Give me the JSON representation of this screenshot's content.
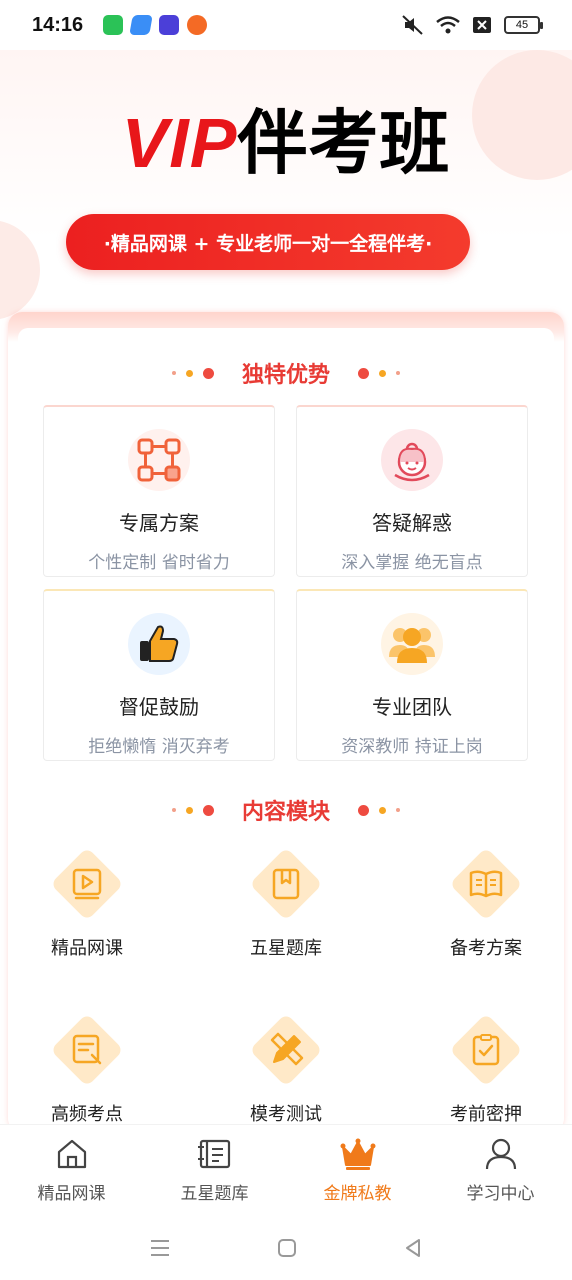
{
  "status_bar": {
    "time": "14:16",
    "battery": "45",
    "icons": [
      "wechat-app-icon",
      "app-blue-icon",
      "game-app-icon",
      "browser-app-icon",
      "mute-icon",
      "wifi-icon",
      "sim-x-icon"
    ]
  },
  "header": {
    "title_vip": "VIP",
    "title_cn": "伴考班",
    "tagline": "·精品网课 + 专业老师一对一全程伴考·"
  },
  "advantages": {
    "title": "独特优势",
    "items": [
      {
        "title": "专属方案",
        "subtitle": "个性定制 省时省力",
        "icon": "plan-network-icon"
      },
      {
        "title": "答疑解惑",
        "subtitle": "深入掌握 绝无盲点",
        "icon": "customer-service-icon"
      },
      {
        "title": "督促鼓励",
        "subtitle": "拒绝懒惰 消灭弃考",
        "icon": "thumbs-up-icon"
      },
      {
        "title": "专业团队",
        "subtitle": "资深教师 持证上岗",
        "icon": "team-icon"
      }
    ]
  },
  "modules": {
    "title": "内容模块",
    "items": [
      {
        "label": "精品网课",
        "icon": "video-icon"
      },
      {
        "label": "五星题库",
        "icon": "bookmark-book-icon"
      },
      {
        "label": "备考方案",
        "icon": "open-book-icon"
      },
      {
        "label": "高频考点",
        "icon": "notes-icon"
      },
      {
        "label": "模考测试",
        "icon": "pencil-ruler-icon"
      },
      {
        "label": "考前密押",
        "icon": "checklist-icon"
      }
    ]
  },
  "bottom_nav": {
    "items": [
      {
        "label": "精品网课",
        "icon": "home-icon",
        "active": false
      },
      {
        "label": "五星题库",
        "icon": "question-bank-icon",
        "active": false
      },
      {
        "label": "金牌私教",
        "icon": "crown-icon",
        "active": true
      },
      {
        "label": "学习中心",
        "icon": "user-icon",
        "active": false
      }
    ]
  },
  "colors": {
    "brand_red": "#e8161a",
    "accent_orange": "#f07a1a",
    "section_title": "#e83b35",
    "module_bg": "#ffe9c8",
    "module_icon": "#f6a623"
  }
}
